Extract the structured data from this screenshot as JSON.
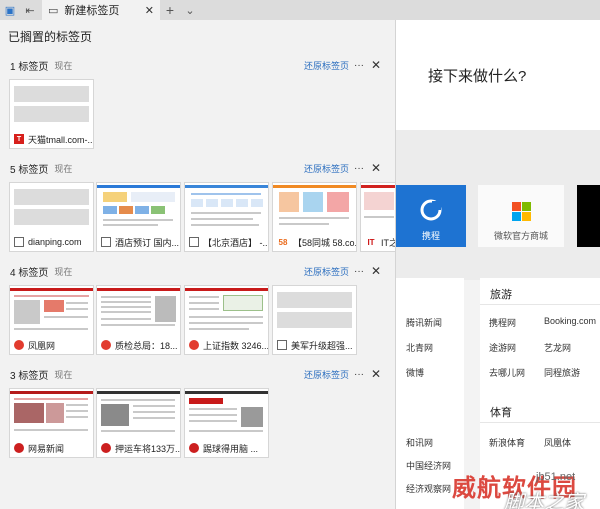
{
  "tabbar": {
    "active_tab_title": "新建标签页",
    "close_glyph": "✕",
    "new_tab_glyph": "+",
    "dropdown_glyph": "⌄"
  },
  "panel": {
    "title": "已搁置的标签页",
    "groups": [
      {
        "count_label": "1 标签页",
        "when": "现在",
        "restore_label": "还原标签页",
        "more_glyph": "···",
        "close_glyph": "✕",
        "tabs": [
          {
            "title": "天猫tmall.com-...",
            "favicon": "tmall-icon"
          }
        ]
      },
      {
        "count_label": "5 标签页",
        "when": "现在",
        "restore_label": "还原标签页",
        "more_glyph": "···",
        "close_glyph": "✕",
        "tabs": [
          {
            "title": "dianping.com",
            "favicon": "page-icon"
          },
          {
            "title": "酒店预订 国内...",
            "favicon": "page-icon"
          },
          {
            "title": "【北京酒店】 -...",
            "favicon": "page-icon"
          },
          {
            "title": "【58同城 58.co...",
            "favicon": "58-icon"
          },
          {
            "title": "IT之家",
            "favicon": "ithome-icon"
          }
        ]
      },
      {
        "count_label": "4 标签页",
        "when": "现在",
        "restore_label": "还原标签页",
        "more_glyph": "···",
        "close_glyph": "✕",
        "tabs": [
          {
            "title": "凤凰网",
            "favicon": "ifeng-icon"
          },
          {
            "title": "质检总局：18...",
            "favicon": "ifeng-icon"
          },
          {
            "title": "上证指数 3246...",
            "favicon": "ifeng-icon"
          },
          {
            "title": "美军升级超强...",
            "favicon": "page-icon"
          }
        ]
      },
      {
        "count_label": "3 标签页",
        "when": "现在",
        "restore_label": "还原标签页",
        "more_glyph": "···",
        "close_glyph": "✕",
        "tabs": [
          {
            "title": "网易新闻",
            "favicon": "netease-icon"
          },
          {
            "title": "押运车将133万...",
            "favicon": "netease-icon"
          },
          {
            "title": "踢球得用脑 ...",
            "favicon": "netease-icon"
          }
        ]
      }
    ]
  },
  "newtab_page": {
    "heading": "接下来做什么?",
    "tiles": [
      {
        "label": "携程"
      },
      {
        "label": "微软官方商城"
      }
    ],
    "cards": [
      {
        "heading": "",
        "links": [
          "腾讯新闻",
          "北青网",
          "微博"
        ]
      },
      {
        "heading": "旅游",
        "links": [
          "携程网",
          "Booking.com",
          "途游网",
          "艺龙网",
          "去哪儿网",
          "同程旅游"
        ]
      },
      {
        "heading": "",
        "links": [
          "和讯网",
          "中国经济网",
          "经济观察网"
        ]
      },
      {
        "heading": "体育",
        "links": [
          "新浪体育",
          "凤凰体"
        ]
      }
    ]
  },
  "watermark": {
    "text1": "威航软件园",
    "text2": "脚本之家",
    "text3": "jb51.net"
  },
  "colors": {
    "link_blue": "#2b6ebf",
    "tile_blue": "#1e73d2",
    "tmall_red": "#d7201c"
  }
}
